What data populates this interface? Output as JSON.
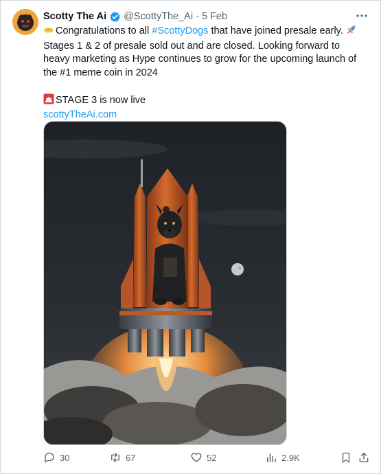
{
  "tweet": {
    "display_name": "Scotty The Ai",
    "handle": "@ScottyThe_Ai",
    "separator": "·",
    "date": "5 Feb",
    "line1_pre": "Congratulations to all ",
    "hashtag": "#ScottyDogs",
    "line1_post": " that have joined presale early. ",
    "paragraph_rest": "Stages 1 & 2 of presale sold out and are closed. Looking forward to heavy marketing as Hype continues to grow for the upcoming launch of the #1 meme coin in 2024",
    "stage_text": "STAGE 3 is now live",
    "link": "scottyTheAi.com"
  },
  "actions": {
    "replies": "30",
    "reposts": "67",
    "likes": "52",
    "views": "2.9K"
  },
  "icons": {
    "verified": "verified-badge-icon",
    "more": "more-horizontal-icon",
    "reply": "reply-icon",
    "repost": "repost-icon",
    "like": "heart-icon",
    "views": "analytics-icon",
    "bookmark": "bookmark-icon",
    "share": "share-icon"
  },
  "colors": {
    "accent": "#1d9bf0",
    "text": "#0f1419",
    "secondary": "#536471",
    "rocket": "#c8602a"
  }
}
